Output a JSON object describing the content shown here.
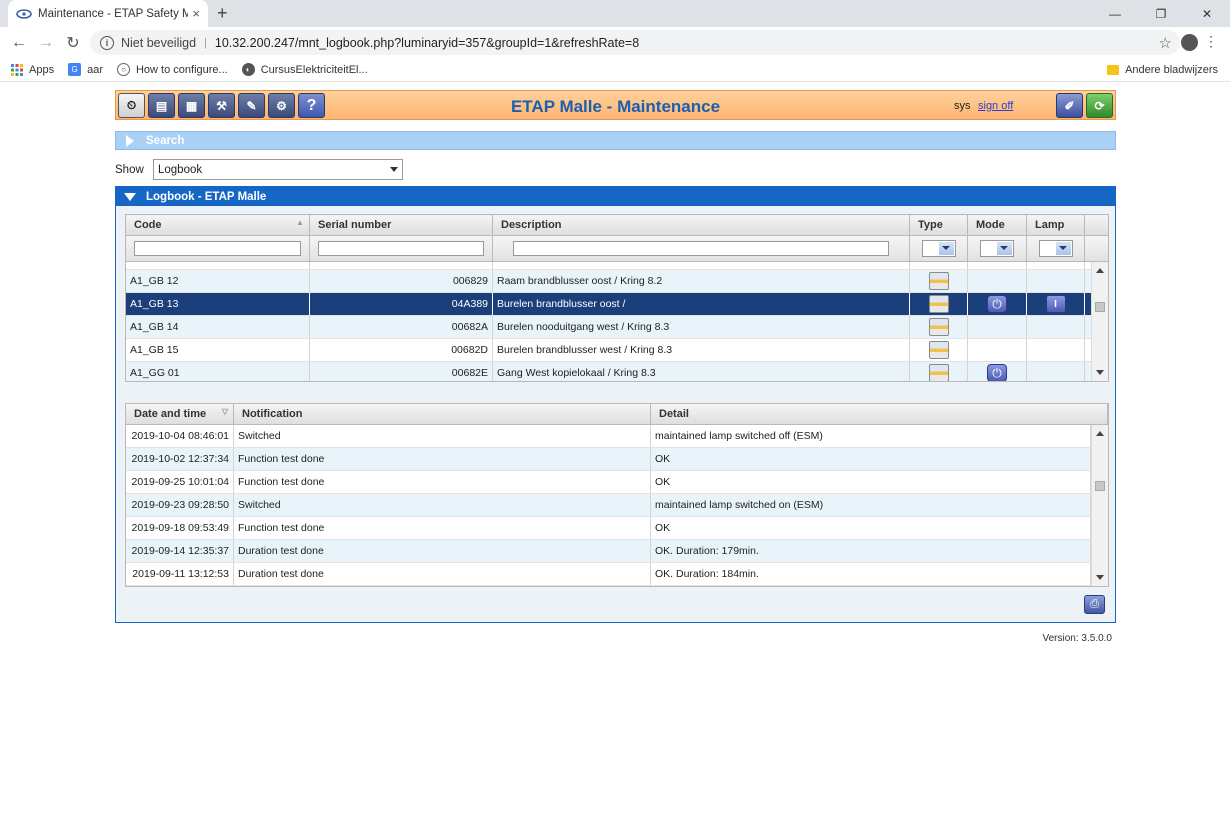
{
  "browser": {
    "tab_title": "Maintenance - ETAP Safety Mana",
    "tab_close": "×",
    "new_tab": "+",
    "win_controls": [
      "—",
      "❐",
      "✕"
    ],
    "security": "Niet beveiligd",
    "url": "10.32.200.247/mnt_logbook.php?luminaryid=357&groupId=1&refreshRate=8",
    "bookmarks": [
      "Apps",
      "aar",
      "How to configure...",
      "CursusElektriciteitEl..."
    ],
    "other_bookmarks": "Andere bladwijzers"
  },
  "header": {
    "title": "ETAP Malle - Maintenance",
    "user": "sys",
    "sign_off": "sign off"
  },
  "search": {
    "label": "Search"
  },
  "show": {
    "label": "Show",
    "selected": "Logbook"
  },
  "panel": {
    "title": "Logbook - ETAP Malle"
  },
  "luminaires": {
    "columns": [
      "Code",
      "Serial number",
      "Description",
      "Type",
      "Mode",
      "Lamp"
    ],
    "rows": [
      {
        "code": "A1_GB 12",
        "serial": "006829",
        "description": "Raam brandblusser oost / Kring 8.2",
        "mode": "",
        "lamp": ""
      },
      {
        "code": "A1_GB 13",
        "serial": "04A389",
        "description": "Burelen brandblusser oost /",
        "mode": "power",
        "lamp": "lamp"
      },
      {
        "code": "A1_GB 14",
        "serial": "00682A",
        "description": "Burelen nooduitgang west / Kring 8.3",
        "mode": "",
        "lamp": ""
      },
      {
        "code": "A1_GB 15",
        "serial": "00682D",
        "description": "Burelen brandblusser west / Kring 8.3",
        "mode": "",
        "lamp": ""
      },
      {
        "code": "A1_GG 01",
        "serial": "00682E",
        "description": "Gang West kopielokaal / Kring 8.3",
        "mode": "power",
        "lamp": ""
      }
    ]
  },
  "log": {
    "columns": [
      "Date and time",
      "Notification",
      "Detail"
    ],
    "rows": [
      {
        "datetime": "2019-10-04 08:46:01",
        "notification": "Switched",
        "detail": "maintained lamp switched off (ESM)"
      },
      {
        "datetime": "2019-10-02 12:37:34",
        "notification": "Function test done",
        "detail": "OK"
      },
      {
        "datetime": "2019-09-25 10:01:04",
        "notification": "Function test done",
        "detail": "OK"
      },
      {
        "datetime": "2019-09-23 09:28:50",
        "notification": "Switched",
        "detail": "maintained lamp switched on (ESM)"
      },
      {
        "datetime": "2019-09-18 09:53:49",
        "notification": "Function test done",
        "detail": "OK"
      },
      {
        "datetime": "2019-09-14 12:35:37",
        "notification": "Duration test done",
        "detail": "OK. Duration: 179min."
      },
      {
        "datetime": "2019-09-11 13:12:53",
        "notification": "Duration test done",
        "detail": "OK. Duration: 184min."
      }
    ]
  },
  "footer": {
    "version": "Version: 3.5.0.0"
  },
  "colors": {
    "accent": "#1566c5",
    "header_bg": "#fdb572",
    "selected_row": "#1b3f7a",
    "title": "#1c5fb0"
  }
}
